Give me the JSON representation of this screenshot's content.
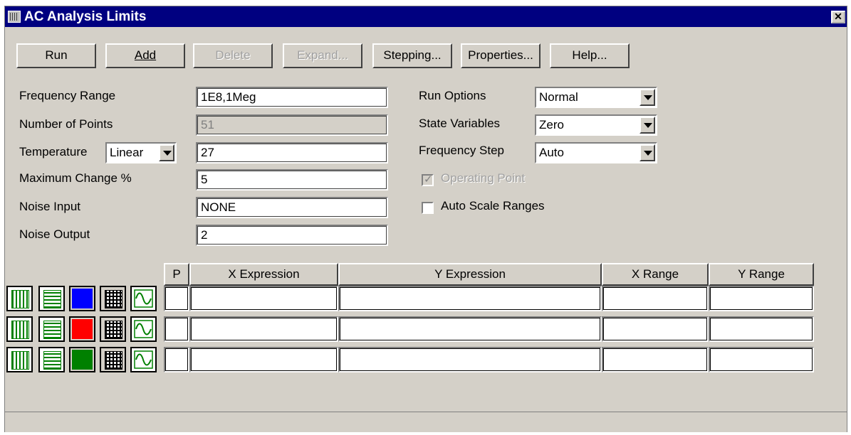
{
  "window": {
    "title": "AC Analysis Limits",
    "close_glyph": "✕"
  },
  "toolbar": [
    {
      "label": "Run",
      "enabled": true
    },
    {
      "label": "Add",
      "enabled": true
    },
    {
      "label": "Delete",
      "enabled": false
    },
    {
      "label": "Expand...",
      "enabled": false
    },
    {
      "label": "Stepping...",
      "enabled": true
    },
    {
      "label": "Properties...",
      "enabled": true
    },
    {
      "label": "Help...",
      "enabled": true
    }
  ],
  "left_fields": [
    {
      "label": "Frequency Range",
      "value": "1E8,1Meg",
      "enabled": true
    },
    {
      "label": "Number of Points",
      "value": "51",
      "enabled": false
    },
    {
      "label": "Temperature",
      "value": "27",
      "enabled": true
    },
    {
      "label": "Maximum Change %",
      "value": "5",
      "enabled": true
    },
    {
      "label": "Noise Input",
      "value": "NONE",
      "enabled": true
    },
    {
      "label": "Noise Output",
      "value": "2",
      "enabled": true
    }
  ],
  "temperature_mode": "Linear",
  "right_options": [
    {
      "label": "Run Options",
      "value": "Normal"
    },
    {
      "label": "State Variables",
      "value": "Zero"
    },
    {
      "label": "Frequency Step",
      "value": "Auto"
    }
  ],
  "checkboxes": [
    {
      "label": "Operating Point",
      "checked": true,
      "enabled": false
    },
    {
      "label": "Auto Scale Ranges",
      "checked": false,
      "enabled": true
    }
  ],
  "table": {
    "headers": [
      "P",
      "X Expression",
      "Y Expression",
      "X Range",
      "Y Range"
    ],
    "rows": [
      {
        "color": "#0000ff",
        "p": "",
        "x_expr": "",
        "y_expr": "",
        "x_range": "",
        "y_range": ""
      },
      {
        "color": "#ff0000",
        "p": "",
        "x_expr": "",
        "y_expr": "",
        "x_range": "",
        "y_range": ""
      },
      {
        "color": "#008000",
        "p": "",
        "x_expr": "",
        "y_expr": "",
        "x_range": "",
        "y_range": ""
      }
    ],
    "row_icons": [
      "vertical-grid-icon",
      "horizontal-grid-icon",
      "curve-color-swatch",
      "table-grid-icon",
      "waveform-icon"
    ]
  }
}
